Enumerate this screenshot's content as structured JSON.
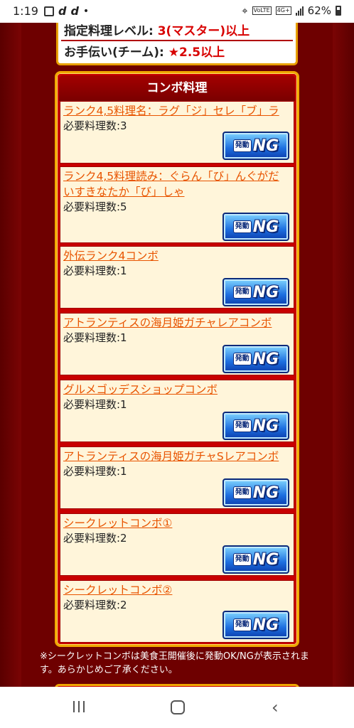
{
  "status_bar": {
    "time": "1:19",
    "icons_left": [
      "d",
      "d"
    ],
    "dot": "•",
    "network": "4G+",
    "volte": "VoLTE",
    "battery": "62%"
  },
  "info": {
    "row1_label": "指定料理レベル: ",
    "row1_value": "3(マスター)以上",
    "row2_label": "お手伝い(チーム): ",
    "row2_value": "★2.5以上"
  },
  "combo": {
    "header": "コンボ料理",
    "button_hatsu": "発動",
    "button_ng": "NG",
    "items": [
      {
        "name": "ランク4,5料理名：ラグ「ジ」セレ「ブ」ラ",
        "req": "必要料理数:3"
      },
      {
        "name": "ランク4,5料理読み：ぐらん「び」んぐがだいすきなたか「び」しゃ",
        "req": "必要料理数:5"
      },
      {
        "name": "外伝ランク4コンボ",
        "req": "必要料理数:1"
      },
      {
        "name": "アトランティスの海月姫ガチャレアコンボ",
        "req": "必要料理数:1"
      },
      {
        "name": "グルメゴッデスショップコンボ",
        "req": "必要料理数:1"
      },
      {
        "name": "アトランティスの海月姫ガチャSレアコンボ",
        "req": "必要料理数:1"
      },
      {
        "name": "シークレットコンボ①",
        "req": "必要料理数:2"
      },
      {
        "name": "シークレットコンボ②",
        "req": "必要料理数:2"
      }
    ]
  },
  "note": "※シークレットコンボは美食王開催後に発動OK/NGが表示されます。あらかじめご了承ください。",
  "nav": {
    "back": "‹"
  }
}
